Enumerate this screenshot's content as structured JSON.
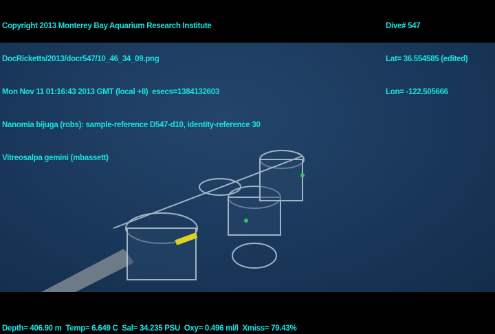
{
  "overlay_top_left": [
    "Copyright 2013 Monterey Bay Aquarium Research Institute",
    "DocRicketts/2013/docr547/10_46_34_09.png",
    "Mon Nov 11 01:16:43 2013 GMT (local +8)  esecs=1384132603",
    "Nanomia bijuga (robs): sample-reference D547-d10, identity-reference 30",
    "Vitreosalpa gemini (mbassett)"
  ],
  "overlay_top_right": [
    "Dive# 547",
    "Lat= 36.554585 (edited)",
    "Lon= -122.505666"
  ],
  "overlay_bottom": "Depth= 406.90 m  Temp= 6.649 C  Sal= 34.235 PSU  Oxy= 0.496 ml/l  Xmiss= 79.43%",
  "colors": {
    "overlay_text": "#19e3e3",
    "water": "#1b3a5e"
  }
}
